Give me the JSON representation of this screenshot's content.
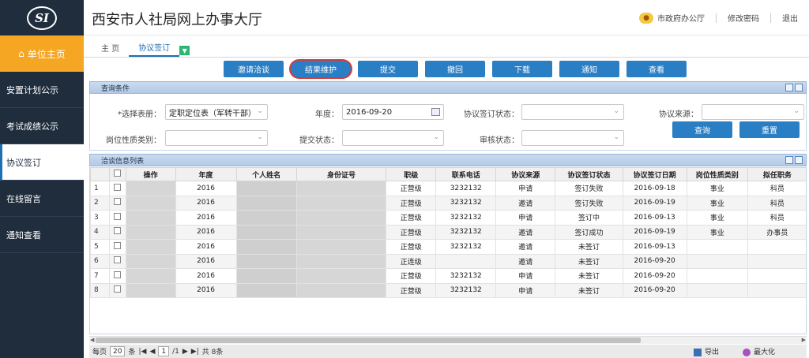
{
  "app_title": "西安市人社局网上办事大厅",
  "header": {
    "office": "市政府办公厅",
    "change_password": "修改密码",
    "logout": "退出"
  },
  "logo_text": "SI",
  "sidebar": {
    "home": "单位主页",
    "items": [
      {
        "label": "安置计划公示"
      },
      {
        "label": "考试成绩公示"
      },
      {
        "label": "协议签订"
      },
      {
        "label": "在线留言"
      },
      {
        "label": "通知查看"
      }
    ]
  },
  "tabs": [
    {
      "label": "主 页"
    },
    {
      "label": "协议签订"
    }
  ],
  "toolbar": [
    "邀请洽谈",
    "结果维护",
    "提交",
    "撤回",
    "下载",
    "通知",
    "查看"
  ],
  "query": {
    "title": "查询条件",
    "select_table_label": "*选择表册：",
    "select_table_value": "定职定位表（军转干部）",
    "year_label": "年度：",
    "year_value": "2016-09-20",
    "sign_status_label": "协议签订状态：",
    "source_label": "协议来源：",
    "post_type_label": "岗位性质类别：",
    "submit_status_label": "提交状态：",
    "review_status_label": "审核状态：",
    "search_btn": "查询",
    "reset_btn": "重置"
  },
  "list": {
    "title": "洽谈信息列表",
    "columns": [
      "",
      "",
      "操作",
      "年度",
      "个人姓名",
      "身份证号",
      "职级",
      "联系电话",
      "协议来源",
      "协议签订状态",
      "协议签订日期",
      "岗位性质类别",
      "拟任职务"
    ],
    "rows": [
      {
        "no": "1",
        "year": "2016",
        "rank": "正营级",
        "phone": "3232132",
        "source": "申请",
        "status": "签订失败",
        "date": "2016-09-18",
        "post": "事业",
        "duty": "科员"
      },
      {
        "no": "2",
        "year": "2016",
        "rank": "正营级",
        "phone": "3232132",
        "source": "邀请",
        "status": "签订失败",
        "date": "2016-09-19",
        "post": "事业",
        "duty": "科员"
      },
      {
        "no": "3",
        "year": "2016",
        "rank": "正营级",
        "phone": "3232132",
        "source": "申请",
        "status": "签订中",
        "date": "2016-09-13",
        "post": "事业",
        "duty": "科员"
      },
      {
        "no": "4",
        "year": "2016",
        "rank": "正营级",
        "phone": "3232132",
        "source": "邀请",
        "status": "签订成功",
        "date": "2016-09-19",
        "post": "事业",
        "duty": "办事员"
      },
      {
        "no": "5",
        "year": "2016",
        "rank": "正营级",
        "phone": "3232132",
        "source": "邀请",
        "status": "未签订",
        "date": "2016-09-13",
        "post": "",
        "duty": ""
      },
      {
        "no": "6",
        "year": "2016",
        "rank": "正连级",
        "phone": "",
        "source": "邀请",
        "status": "未签订",
        "date": "2016-09-20",
        "post": "",
        "duty": ""
      },
      {
        "no": "7",
        "year": "2016",
        "rank": "正营级",
        "phone": "3232132",
        "source": "申请",
        "status": "未签订",
        "date": "2016-09-20",
        "post": "",
        "duty": ""
      },
      {
        "no": "8",
        "year": "2016",
        "rank": "正营级",
        "phone": "3232132",
        "source": "申请",
        "status": "未签订",
        "date": "2016-09-20",
        "post": "",
        "duty": ""
      }
    ]
  },
  "pager": {
    "per_page_label": "每页",
    "per_page": "20",
    "unit": "条",
    "page": "1",
    "total_pages": "/1",
    "total": "共 8条",
    "export": "导出",
    "maximize": "最大化"
  }
}
